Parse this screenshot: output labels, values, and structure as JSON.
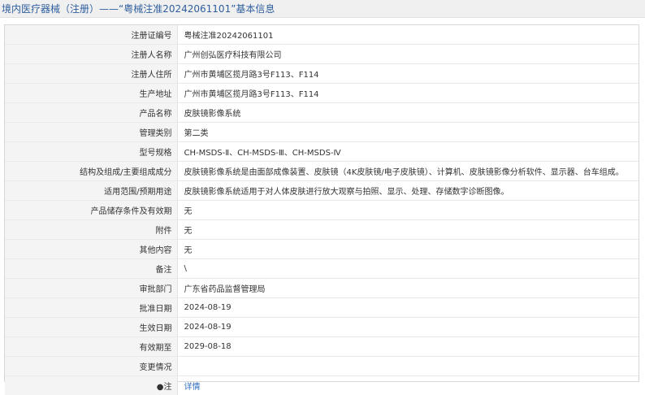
{
  "header": {
    "title": "境内医疗器械（注册）——“粤械注准20242061101”基本信息"
  },
  "rows": [
    {
      "label": "注册证编号",
      "value": "粤械注准20242061101"
    },
    {
      "label": "注册人名称",
      "value": "广州创弘医疗科技有限公司"
    },
    {
      "label": "注册人住所",
      "value": "广州市黄埔区揽月路3号F113、F114"
    },
    {
      "label": "生产地址",
      "value": "广州市黄埔区揽月路3号F113、F114"
    },
    {
      "label": "产品名称",
      "value": "皮肤镜影像系统"
    },
    {
      "label": "管理类别",
      "value": "第二类"
    },
    {
      "label": "型号规格",
      "value": "CH-MSDS-Ⅱ、CH-MSDS-Ⅲ、CH-MSDS-Ⅳ"
    },
    {
      "label": "结构及组成/主要组成成分",
      "value": "皮肤镜影像系统是由面部成像装置、皮肤镜（4K皮肤镜/电子皮肤镜）、计算机、皮肤镜影像分析软件、显示器、台车组成。"
    },
    {
      "label": "适用范围/预期用途",
      "value": "皮肤镜影像系统适用于对人体皮肤进行放大观察与拍照、显示、处理、存储数字诊断图像。"
    },
    {
      "label": "产品储存条件及有效期",
      "value": "无"
    },
    {
      "label": "附件",
      "value": "无"
    },
    {
      "label": "其他内容",
      "value": "无"
    },
    {
      "label": "备注",
      "value": "\\"
    },
    {
      "label": "审批部门",
      "value": "广东省药品监督管理局"
    },
    {
      "label": "批准日期",
      "value": "2024-08-19"
    },
    {
      "label": "生效日期",
      "value": "2024-08-19"
    },
    {
      "label": "有效期至",
      "value": "2029-08-18"
    },
    {
      "label": "变更情况",
      "value": ""
    },
    {
      "label": "●注",
      "value": "详情"
    }
  ]
}
